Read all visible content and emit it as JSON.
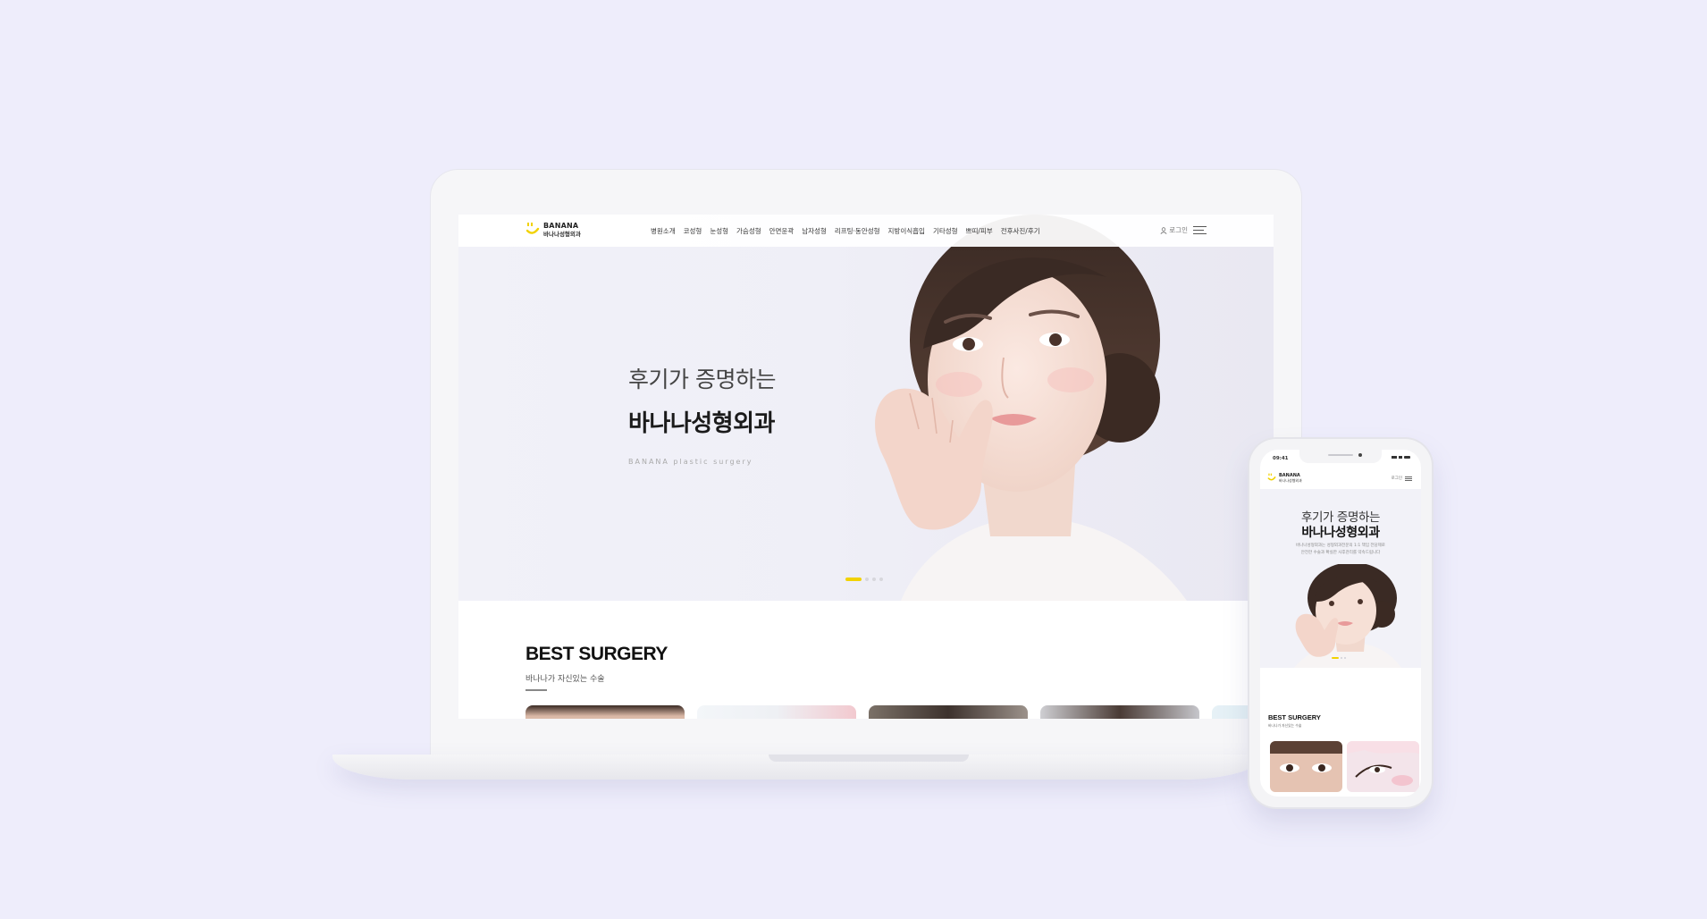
{
  "desktop": {
    "logo": {
      "en": "BANANA",
      "ko": "바나나성형외과"
    },
    "nav": [
      "병원소개",
      "코성형",
      "눈성형",
      "가슴성형",
      "안면윤곽",
      "남자성형",
      "리프팅·동안성형",
      "지방이식흡입",
      "기타성형",
      "쁘띠/피부",
      "전후사진/후기"
    ],
    "login_label": "로그인",
    "hero": {
      "subtitle": "후기가 증명하는",
      "title": "바나나성형외과",
      "english": "BANANA plastic surgery"
    },
    "best": {
      "title": "BEST SURGERY",
      "subtitle": "바나나가 자신있는 수술"
    }
  },
  "mobile": {
    "status_time": "09:41",
    "logo": {
      "en": "BANANA",
      "ko": "바나나성형외과"
    },
    "login_label": "로그인",
    "hero": {
      "subtitle": "후기가 증명하는",
      "title": "바나나성형외과",
      "desc_line1": "바나나성형외과는 성형외과전문의 1:1 책임 전담제로",
      "desc_line2": "안전한 수술과 확실한 사후관리를 약속드립니다"
    },
    "best": {
      "title": "BEST SURGERY",
      "subtitle": "바나나가 자신있는 수술"
    }
  },
  "colors": {
    "background": "#eeedfb",
    "accent_yellow": "#f2d200"
  }
}
